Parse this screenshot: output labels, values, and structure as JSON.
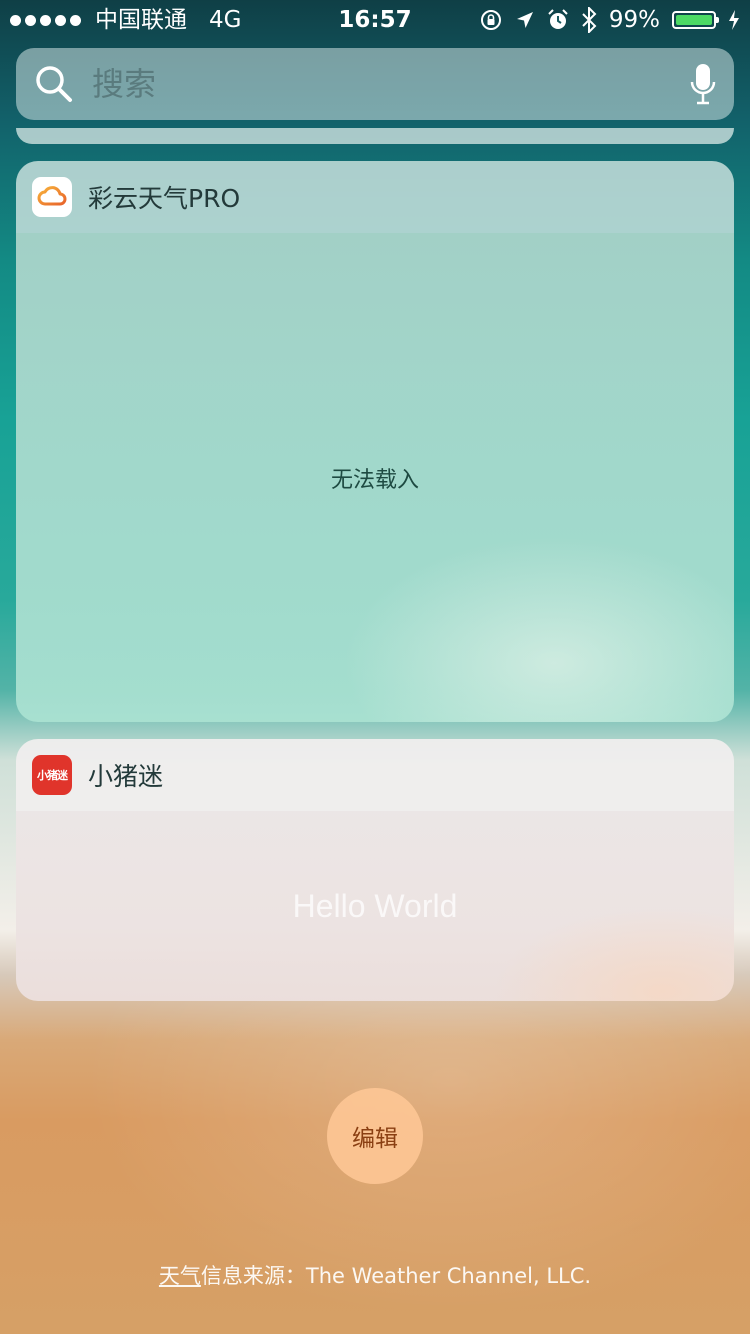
{
  "status_bar": {
    "carrier": "中国联通",
    "network": "4G",
    "time": "16:57",
    "battery_percent": "99%",
    "battery_level": 0.99,
    "battery_color": "#4cd964",
    "icons": [
      "signal-dots-icon",
      "orientation-lock-icon",
      "location-arrow-icon",
      "alarm-icon",
      "bluetooth-icon",
      "battery-icon",
      "charging-bolt-icon"
    ]
  },
  "search": {
    "placeholder": "搜索",
    "value": ""
  },
  "widgets": [
    {
      "app_name": "彩云天气PRO",
      "icon": "cloud-icon",
      "body_text": "无法载入"
    },
    {
      "app_name": "小猪迷",
      "icon_text": "小猪迷",
      "icon_color": "#e0342b",
      "body_text": "Hello World"
    }
  ],
  "edit_button": {
    "label": "编辑"
  },
  "footer": {
    "link_text": "天气",
    "text": "信息来源：The Weather Channel, LLC."
  }
}
